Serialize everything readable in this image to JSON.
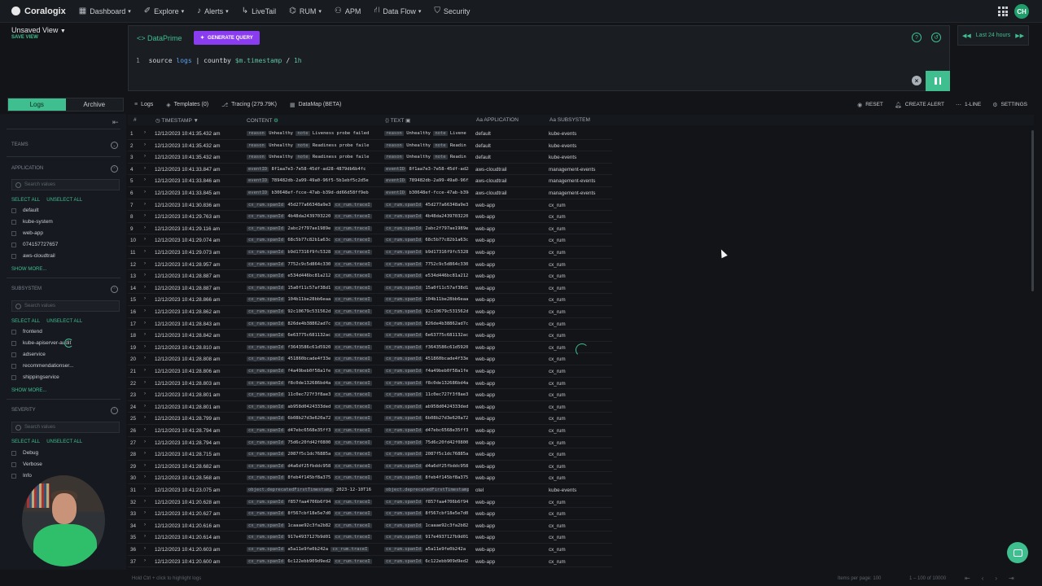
{
  "nav": {
    "brand": "Coralogix",
    "items": [
      {
        "icon": "dashboard-icon",
        "label": "Dashboard",
        "caret": true
      },
      {
        "icon": "explore-icon",
        "label": "Explore",
        "caret": true
      },
      {
        "icon": "bell-icon",
        "label": "Alerts",
        "caret": true
      },
      {
        "icon": "livetail-icon",
        "label": "LiveTail",
        "caret": false
      },
      {
        "icon": "rum-icon",
        "label": "RUM",
        "caret": true
      },
      {
        "icon": "apm-icon",
        "label": "APM",
        "caret": false
      },
      {
        "icon": "dataflow-icon",
        "label": "Data Flow",
        "caret": true
      },
      {
        "icon": "shield-icon",
        "label": "Security",
        "caret": false
      }
    ],
    "avatar": "CH"
  },
  "view": {
    "name": "Unsaved View",
    "save": "SAVE VIEW"
  },
  "query": {
    "mode": "DataPrime",
    "generate": "GENERATE QUERY",
    "line_no": "1",
    "tokens": [
      "source",
      "logs",
      "|",
      "countby",
      "$m.timestamp",
      "/",
      "1h"
    ]
  },
  "time": {
    "label": "Last 24 hours"
  },
  "sidebar": {
    "tabs": [
      "Logs",
      "Archive"
    ],
    "sections": [
      {
        "title": "TEAMS",
        "options": []
      },
      {
        "title": "APPLICATION",
        "search": "Search values",
        "select_all": "SELECT ALL",
        "unselect_all": "UNSELECT ALL",
        "options": [
          "default",
          "kube-system",
          "web-app",
          "074157727657",
          "aws-cloudtrail"
        ],
        "more": "SHOW MORE..."
      },
      {
        "title": "SUBSYSTEM",
        "search": "Search values",
        "select_all": "SELECT ALL",
        "unselect_all": "UNSELECT ALL",
        "options": [
          "frontend",
          "kube-apiserver-audit",
          "adservice",
          "recommendationser...",
          "shippingservice"
        ],
        "more": "SHOW MORE..."
      },
      {
        "title": "SEVERITY",
        "search": "Search values",
        "select_all": "SELECT ALL",
        "unselect_all": "UNSELECT ALL",
        "options": [
          "Debug",
          "Verbose",
          "Info"
        ]
      }
    ]
  },
  "toolbar": {
    "tabs": [
      "Logs",
      "Templates (0)",
      "Tracing (279.79K)",
      "DataMap (BETA)"
    ],
    "actions": [
      "RESET",
      "CREATE ALERT",
      "1-LINE",
      "SETTINGS"
    ]
  },
  "columns": [
    "#",
    "TIMESTAMP",
    "CONTENT",
    "TEXT",
    "APPLICATION",
    "SUBSYSTEM"
  ],
  "rows": [
    {
      "n": "1",
      "ts": "12/12/2023 10:41:35.432 am",
      "k1": "reason",
      "v1": "Unhealthy",
      "k2": "note",
      "v2": "Liveness probe failed",
      "t2": "Livene",
      "app": "default",
      "sub": "kube-events"
    },
    {
      "n": "2",
      "ts": "12/12/2023 10:41:35.432 am",
      "k1": "reason",
      "v1": "Unhealthy",
      "k2": "note",
      "v2": "Readiness probe faile",
      "t2": "Readin",
      "app": "default",
      "sub": "kube-events"
    },
    {
      "n": "3",
      "ts": "12/12/2023 10:41:35.432 am",
      "k1": "reason",
      "v1": "Unhealthy",
      "k2": "note",
      "v2": "Readiness probe faile",
      "t2": "Readin",
      "app": "default",
      "sub": "kube-events"
    },
    {
      "n": "4",
      "ts": "12/12/2023 10:41:33.847 am",
      "k1": "eventID",
      "v1": "8f1aa7e3-7e58-45df-ad28-4879db6b4fc",
      "k2": "",
      "v2": "",
      "t2": "",
      "app": "aws-cloudtrail",
      "sub": "management-events"
    },
    {
      "n": "5",
      "ts": "12/12/2023 10:41:33.846 am",
      "k1": "eventID",
      "v1": "789482db-2a99-49a0-96f5-5b1ebf5c2d5e",
      "k2": "",
      "v2": "",
      "t2": "",
      "app": "aws-cloudtrail",
      "sub": "management-events"
    },
    {
      "n": "6",
      "ts": "12/12/2023 10:41:33.845 am",
      "k1": "eventID",
      "v1": "b30648ef-fcce-47ab-b39d-dd66d58ff9eb",
      "k2": "",
      "v2": "",
      "t2": "",
      "app": "aws-cloudtrail",
      "sub": "management-events"
    },
    {
      "n": "7",
      "ts": "12/12/2023 10:41:30.836 am",
      "k1": "cx_rum.spanId",
      "v1": "45d277a66348a9e3",
      "k2": "cx_rum.traceI",
      "v2": "",
      "t2": "",
      "app": "web-app",
      "sub": "cx_rum"
    },
    {
      "n": "8",
      "ts": "12/12/2023 10:41:29.763 am",
      "k1": "cx_rum.spanId",
      "v1": "4b48da2439703220",
      "k2": "cx_rum.traceI",
      "v2": "",
      "t2": "",
      "app": "web-app",
      "sub": "cx_rum"
    },
    {
      "n": "9",
      "ts": "12/12/2023 10:41:29.116 am",
      "k1": "cx_rum.spanId",
      "v1": "2abc2f797ae1989e",
      "k2": "cx_rum.traceI",
      "v2": "",
      "t2": "",
      "app": "web-app",
      "sub": "cx_rum"
    },
    {
      "n": "10",
      "ts": "12/12/2023 10:41:29.074 am",
      "k1": "cx_rum.spanId",
      "v1": "68c5b77c82b1a63c",
      "k2": "cx_rum.traceI",
      "v2": "",
      "t2": "",
      "app": "web-app",
      "sub": "cx_rum"
    },
    {
      "n": "11",
      "ts": "12/12/2023 10:41:29.073 am",
      "k1": "cx_rum.spanId",
      "v1": "b9d17316f9fc5328",
      "k2": "cx_rum.traceI",
      "v2": "",
      "t2": "",
      "app": "web-app",
      "sub": "cx_rum"
    },
    {
      "n": "12",
      "ts": "12/12/2023 10:41:28.957 am",
      "k1": "cx_rum.spanId",
      "v1": "7752c9c5d864c330",
      "k2": "cx_rum.traceI",
      "v2": "",
      "t2": "",
      "app": "web-app",
      "sub": "cx_rum"
    },
    {
      "n": "13",
      "ts": "12/12/2023 10:41:28.887 am",
      "k1": "cx_rum.spanId",
      "v1": "e534d446bc81a212",
      "k2": "cx_rum.traceI",
      "v2": "",
      "t2": "",
      "app": "web-app",
      "sub": "cx_rum"
    },
    {
      "n": "14",
      "ts": "12/12/2023 10:41:28.887 am",
      "k1": "cx_rum.spanId",
      "v1": "15a0f11c57af38d1",
      "k2": "cx_rum.traceI",
      "v2": "",
      "t2": "",
      "app": "web-app",
      "sub": "cx_rum"
    },
    {
      "n": "15",
      "ts": "12/12/2023 10:41:28.866 am",
      "k1": "cx_rum.spanId",
      "v1": "104b11be28bb6eaa",
      "k2": "cx_rum.traceI",
      "v2": "",
      "t2": "",
      "app": "web-app",
      "sub": "cx_rum"
    },
    {
      "n": "16",
      "ts": "12/12/2023 10:41:28.862 am",
      "k1": "cx_rum.spanId",
      "v1": "92c10679c531562d",
      "k2": "cx_rum.traceI",
      "v2": "",
      "t2": "",
      "app": "web-app",
      "sub": "cx_rum"
    },
    {
      "n": "17",
      "ts": "12/12/2023 10:41:28.843 am",
      "k1": "cx_rum.spanId",
      "v1": "826de4b38862ad7c",
      "k2": "cx_rum.traceI",
      "v2": "",
      "t2": "",
      "app": "web-app",
      "sub": "cx_rum"
    },
    {
      "n": "18",
      "ts": "12/12/2023 10:41:28.842 am",
      "k1": "cx_rum.spanId",
      "v1": "6e63775c681132ac",
      "k2": "cx_rum.traceI",
      "v2": "",
      "t2": "",
      "app": "web-app",
      "sub": "cx_rum"
    },
    {
      "n": "19",
      "ts": "12/12/2023 10:41:28.810 am",
      "k1": "cx_rum.spanId",
      "v1": "f3643586c61d5920",
      "k2": "cx_rum.traceI",
      "v2": "",
      "t2": "",
      "app": "web-app",
      "sub": "cx_rum"
    },
    {
      "n": "20",
      "ts": "12/12/2023 10:41:28.808 am",
      "k1": "cx_rum.spanId",
      "v1": "451860bcade4f33e",
      "k2": "cx_rum.traceI",
      "v2": "",
      "t2": "",
      "app": "web-app",
      "sub": "cx_rum"
    },
    {
      "n": "21",
      "ts": "12/12/2023 10:41:28.806 am",
      "k1": "cx_rum.spanId",
      "v1": "f4a49beb0f58a1fe",
      "k2": "cx_rum.traceI",
      "v2": "",
      "t2": "",
      "app": "web-app",
      "sub": "cx_rum"
    },
    {
      "n": "22",
      "ts": "12/12/2023 10:41:28.803 am",
      "k1": "cx_rum.spanId",
      "v1": "f8c0de132686bd4a",
      "k2": "cx_rum.traceI",
      "v2": "",
      "t2": "",
      "app": "web-app",
      "sub": "cx_rum"
    },
    {
      "n": "23",
      "ts": "12/12/2023 10:41:28.801 am",
      "k1": "cx_rum.spanId",
      "v1": "11c0ec727f3f8ae3",
      "k2": "cx_rum.traceI",
      "v2": "",
      "t2": "",
      "app": "web-app",
      "sub": "cx_rum"
    },
    {
      "n": "24",
      "ts": "12/12/2023 10:41:28.801 am",
      "k1": "cx_rum.spanId",
      "v1": "ab958d0424333ded",
      "k2": "cx_rum.traceI",
      "v2": "",
      "t2": "",
      "app": "web-app",
      "sub": "cx_rum"
    },
    {
      "n": "25",
      "ts": "12/12/2023 10:41:28.799 am",
      "k1": "cx_rum.spanId",
      "v1": "6b08b27d3e620a72",
      "k2": "cx_rum.traceI",
      "v2": "",
      "t2": "",
      "app": "web-app",
      "sub": "cx_rum"
    },
    {
      "n": "26",
      "ts": "12/12/2023 10:41:28.794 am",
      "k1": "cx_rum.spanId",
      "v1": "d47ebc6568e35ff3",
      "k2": "cx_rum.traceI",
      "v2": "",
      "t2": "",
      "app": "web-app",
      "sub": "cx_rum"
    },
    {
      "n": "27",
      "ts": "12/12/2023 10:41:28.794 am",
      "k1": "cx_rum.spanId",
      "v1": "75d6c20fd42f0800",
      "k2": "cx_rum.traceI",
      "v2": "",
      "t2": "",
      "app": "web-app",
      "sub": "cx_rum"
    },
    {
      "n": "28",
      "ts": "12/12/2023 10:41:28.715 am",
      "k1": "cx_rum.spanId",
      "v1": "2087f5c1dc76885a",
      "k2": "cx_rum.traceI",
      "v2": "",
      "t2": "",
      "app": "web-app",
      "sub": "cx_rum"
    },
    {
      "n": "29",
      "ts": "12/12/2023 10:41:28.682 am",
      "k1": "cx_rum.spanId",
      "v1": "d4a6df25fbddc958",
      "k2": "cx_rum.traceI",
      "v2": "",
      "t2": "",
      "app": "web-app",
      "sub": "cx_rum"
    },
    {
      "n": "30",
      "ts": "12/12/2023 10:41:28.568 am",
      "k1": "cx_rum.spanId",
      "v1": "8feb4f145bf8a375",
      "k2": "cx_rum.traceI",
      "v2": "",
      "t2": "",
      "app": "web-app",
      "sub": "cx_rum"
    },
    {
      "n": "31",
      "ts": "12/12/2023 10:41:23.075 am",
      "k1": "object.deprecatedFirstTimestamp",
      "v1": "2023-12-10T16",
      "k2": "",
      "v2": "",
      "t2": "",
      "app": "otel",
      "sub": "kube-events"
    },
    {
      "n": "32",
      "ts": "12/12/2023 10:41:20.628 am",
      "k1": "cx_rum.spanId",
      "v1": "f857faa4706b6f94",
      "k2": "cx_rum.traceI",
      "v2": "",
      "t2": "",
      "app": "web-app",
      "sub": "cx_rum"
    },
    {
      "n": "33",
      "ts": "12/12/2023 10:41:20.627 am",
      "k1": "cx_rum.spanId",
      "v1": "8f567cbf18e5e7d0",
      "k2": "cx_rum.traceI",
      "v2": "",
      "t2": "",
      "app": "web-app",
      "sub": "cx_rum"
    },
    {
      "n": "34",
      "ts": "12/12/2023 10:41:20.616 am",
      "k1": "cx_rum.spanId",
      "v1": "1caaae92c3fa2b82",
      "k2": "cx_rum.traceI",
      "v2": "",
      "t2": "",
      "app": "web-app",
      "sub": "cx_rum"
    },
    {
      "n": "35",
      "ts": "12/12/2023 10:41:20.614 am",
      "k1": "cx_rum.spanId",
      "v1": "917e4937127b9d01",
      "k2": "cx_rum.traceI",
      "v2": "",
      "t2": "",
      "app": "web-app",
      "sub": "cx_rum"
    },
    {
      "n": "36",
      "ts": "12/12/2023 10:41:20.603 am",
      "k1": "cx_rum.spanId",
      "v1": "a5a11e9fe0b242a",
      "k2": "cx_rum.traceI",
      "v2": "",
      "t2": "",
      "app": "web-app",
      "sub": "cx_rum"
    },
    {
      "n": "37",
      "ts": "12/12/2023 10:41:20.600 am",
      "k1": "cx_rum.spanId",
      "v1": "6c122ebb909d9ed2",
      "k2": "cx_rum.traceI",
      "v2": "",
      "t2": "",
      "app": "web-app",
      "sub": "cx_rum"
    }
  ],
  "footer": {
    "hint": "Hold Ctrl + click to highlight logs",
    "per_page_label": "Items per page:",
    "per_page": "100",
    "range": "1 – 100 of 10000"
  }
}
